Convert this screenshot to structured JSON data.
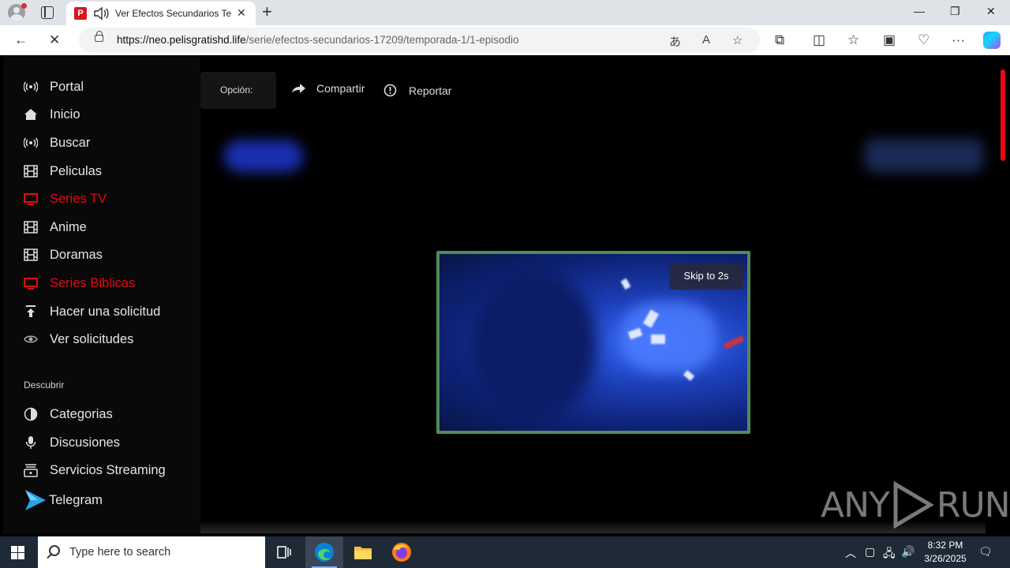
{
  "browser": {
    "tab_title": "Ver Efectos Secundarios Tem",
    "favicon_letter": "P",
    "url_host": "https://neo.pelisgratishd.life",
    "url_path": "/serie/efectos-secundarios-17209/temporada-1/1-episodio",
    "icons": [
      "profile-icon",
      "tabs-icon",
      "speaker-icon",
      "close-icon",
      "new-tab-icon",
      "minimize-icon",
      "restore-icon",
      "window-close-icon",
      "back-icon",
      "stop-icon",
      "lock-icon",
      "translate-icon",
      "read-aloud-icon",
      "favorite-icon",
      "extensions-icon",
      "split-screen-icon",
      "favorites-icon",
      "collections-icon",
      "performance-icon",
      "more-icon",
      "copilot-icon"
    ]
  },
  "sidebar": {
    "items": [
      {
        "label": "Portal",
        "icon": "broadcast-icon",
        "active": false
      },
      {
        "label": "Inicio",
        "icon": "home-icon",
        "active": false
      },
      {
        "label": "Buscar",
        "icon": "broadcast-icon",
        "active": false
      },
      {
        "label": "Peliculas",
        "icon": "film-icon",
        "active": false
      },
      {
        "label": "Series TV",
        "icon": "tv-icon",
        "active": true
      },
      {
        "label": "Anime",
        "icon": "film-icon",
        "active": false
      },
      {
        "label": "Doramas",
        "icon": "film-icon",
        "active": false
      },
      {
        "label": "Series Biblicas",
        "icon": "tv-icon",
        "active": true
      },
      {
        "label": "Hacer una solicitud",
        "icon": "upload-icon",
        "active": false
      },
      {
        "label": "Ver solicitudes",
        "icon": "eye-icon",
        "active": false
      }
    ],
    "discover_heading": "Descubrir",
    "discover_items": [
      {
        "label": "Categorias",
        "icon": "contrast-icon"
      },
      {
        "label": "Discusiones",
        "icon": "microphone-icon"
      },
      {
        "label": "Servicios Streaming",
        "icon": "streaming-icon"
      },
      {
        "label": "Telegram",
        "icon": "telegram-icon"
      }
    ]
  },
  "player_bar": {
    "option_label": "Opción:",
    "share_label": "Compartir",
    "report_label": "Reportar"
  },
  "ad": {
    "skip_label": "Skip to 2s"
  },
  "watermark": {
    "text_left": "ANY",
    "text_right": "RUN"
  },
  "taskbar": {
    "search_placeholder": "Type here to search",
    "time": "8:32 PM",
    "date": "3/26/2025"
  },
  "colors": {
    "accent_red": "#e50914",
    "video_border": "#4f8a5b"
  }
}
